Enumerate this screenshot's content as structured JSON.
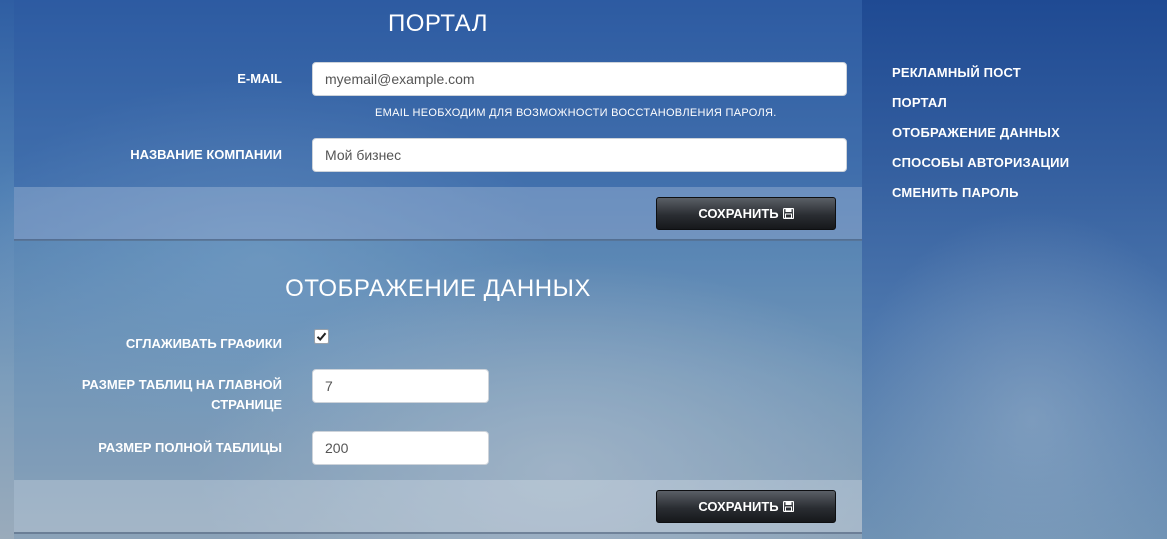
{
  "portal": {
    "title": "ПОРТАЛ",
    "email_label": "E-MAIL",
    "email_value": "myemail@example.com",
    "email_help": "EMAIL НЕОБХОДИМ ДЛЯ ВОЗМОЖНОСТИ ВОССТАНОВЛЕНИЯ ПАРОЛЯ.",
    "company_label": "НАЗВАНИЕ КОМПАНИИ",
    "company_value": "Мой бизнес",
    "save_label": "СОХРАНИТЬ"
  },
  "display": {
    "title": "ОТОБРАЖЕНИЕ ДАННЫХ",
    "smooth_label": "СГЛАЖИВАТЬ ГРАФИКИ",
    "smooth_checked": true,
    "home_table_label_line1": "РАЗМЕР ТАБЛИЦ НА ГЛАВНОЙ",
    "home_table_label_line2": "СТРАНИЦЕ",
    "home_table_value": "7",
    "full_table_label": "РАЗМЕР ПОЛНОЙ ТАБЛИЦЫ",
    "full_table_value": "200",
    "save_label": "СОХРАНИТЬ"
  },
  "sidebar": {
    "items": [
      {
        "label": "РЕКЛАМНЫЙ ПОСТ"
      },
      {
        "label": "ПОРТАЛ"
      },
      {
        "label": "ОТОБРАЖЕНИЕ ДАННЫХ"
      },
      {
        "label": "СПОСОБЫ АВТОРИЗАЦИИ"
      },
      {
        "label": "СМЕНИТЬ ПАРОЛЬ"
      }
    ]
  },
  "icons": {
    "save": "floppy-disk-icon",
    "check": "checkmark-icon"
  }
}
